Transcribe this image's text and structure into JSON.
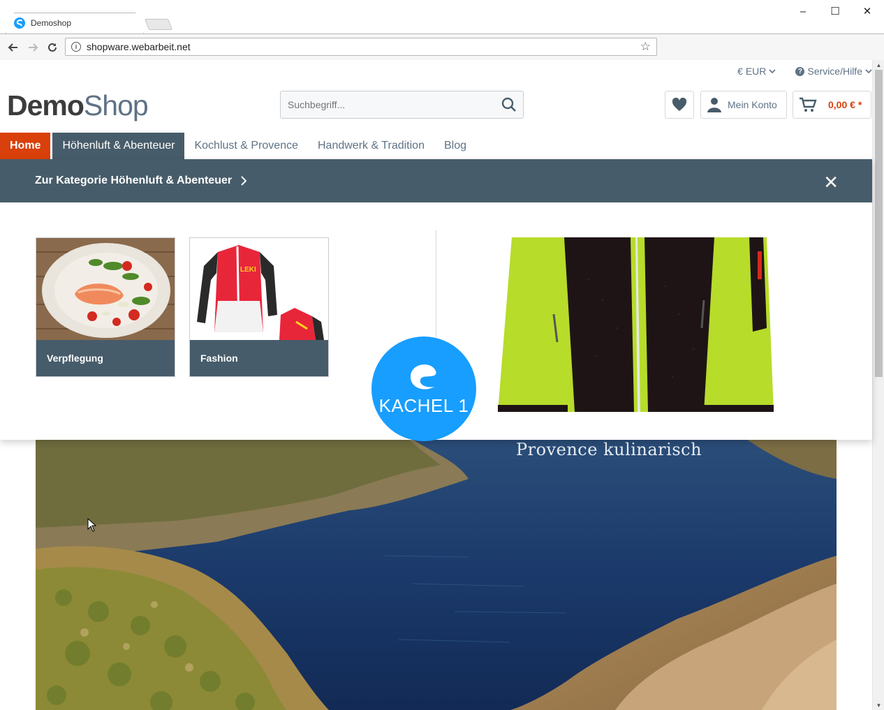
{
  "browser": {
    "tab_title": "Demoshop",
    "url": "shopware.webarbeit.net",
    "controls": {
      "minimize": "–",
      "maximize": "☐",
      "close": "✕"
    }
  },
  "top_bar": {
    "currency": "€ EUR",
    "service": "Service/Hilfe"
  },
  "header": {
    "logo_demo": "Demo",
    "logo_shop": "Shop",
    "search_placeholder": "Suchbegriff...",
    "account_label": "Mein Konto",
    "cart_amount": "0,00 € *"
  },
  "nav": {
    "items": [
      {
        "label": "Home"
      },
      {
        "label": "Höhenluft & Abenteuer"
      },
      {
        "label": "Kochlust & Provence"
      },
      {
        "label": "Handwerk & Tradition"
      },
      {
        "label": "Blog"
      }
    ]
  },
  "flyout": {
    "category_link": "Zur Kategorie Höhenluft & Abenteuer",
    "close": "✕",
    "categories": [
      {
        "label": "Verpflegung"
      },
      {
        "label": "Fashion"
      }
    ],
    "badge_text": "KACHEL 1",
    "jacket_brand": "LEKI"
  },
  "banner": {
    "title": "Provence kulinarisch"
  },
  "colors": {
    "accent": "#d9400b",
    "nav_dark": "#475c6a",
    "badge_blue": "#189eff",
    "text_muted": "#5f7285"
  }
}
